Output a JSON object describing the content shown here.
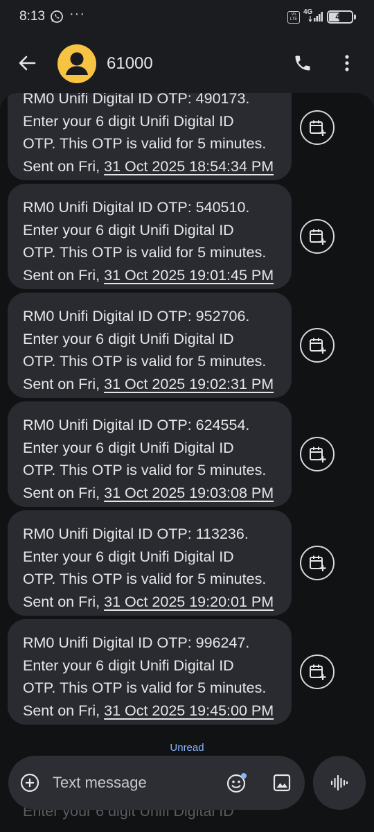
{
  "status_bar": {
    "time": "8:13",
    "more_dots": "···",
    "volte": "Vo LTE",
    "network": "4G",
    "battery": "48",
    "battery_level": 0.48
  },
  "app_bar": {
    "contact_name": "61000",
    "back_icon": "arrow-back-icon",
    "call_icon": "phone-icon",
    "more_icon": "more-vert-icon"
  },
  "colors": {
    "background": "#1b1c20",
    "conversation": "#111214",
    "bubble": "#2a2b30",
    "avatar": "#f6c342",
    "accent": "#8ab4f8"
  },
  "messages": [
    {
      "line1": "RM0 Unifi Digital ID OTP: 490173.",
      "line2": "Enter your 6 digit Unifi Digital ID",
      "line3": "OTP. This OTP is valid for 5 minutes.",
      "sent_prefix": "Sent on Fri, ",
      "sent_date": "31 Oct 2025 18:54:34 PM"
    },
    {
      "line1": "RM0 Unifi Digital ID OTP: 540510.",
      "line2": "Enter your 6 digit Unifi Digital ID",
      "line3": "OTP. This OTP is valid for 5 minutes.",
      "sent_prefix": "Sent on Fri, ",
      "sent_date": "31 Oct 2025 19:01:45 PM"
    },
    {
      "line1": "RM0 Unifi Digital ID OTP: 952706.",
      "line2": "Enter your 6 digit Unifi Digital ID",
      "line3": "OTP. This OTP is valid for 5 minutes.",
      "sent_prefix": "Sent on Fri, ",
      "sent_date": "31 Oct 2025 19:02:31 PM"
    },
    {
      "line1": "RM0 Unifi Digital ID OTP: 624554.",
      "line2": "Enter your 6 digit Unifi Digital ID",
      "line3": "OTP. This OTP is valid for 5 minutes.",
      "sent_prefix": "Sent on Fri, ",
      "sent_date": "31 Oct 2025 19:03:08 PM"
    },
    {
      "line1": "RM0 Unifi Digital ID OTP: 113236.",
      "line2": "Enter your 6 digit Unifi Digital ID",
      "line3": "OTP. This OTP is valid for 5 minutes.",
      "sent_prefix": "Sent on Fri, ",
      "sent_date": "31 Oct 2025 19:20:01 PM"
    },
    {
      "line1": "RM0 Unifi Digital ID OTP: 996247.",
      "line2": "Enter your 6 digit Unifi Digital ID",
      "line3": "OTP. This OTP is valid for 5 minutes.",
      "sent_prefix": "Sent on Fri, ",
      "sent_date": "31 Oct 2025 19:45:00 PM"
    }
  ],
  "message_action_icon": "calendar-add-icon",
  "unread_label": "Unread",
  "underlay_text": "Enter your 6 digit Unifi Digital ID",
  "compose": {
    "placeholder": "Text message",
    "add_icon": "add-circle-icon",
    "emoji_icon": "emoji-icon",
    "media_icon": "image-icon",
    "voice_icon": "voice-waveform-icon"
  }
}
